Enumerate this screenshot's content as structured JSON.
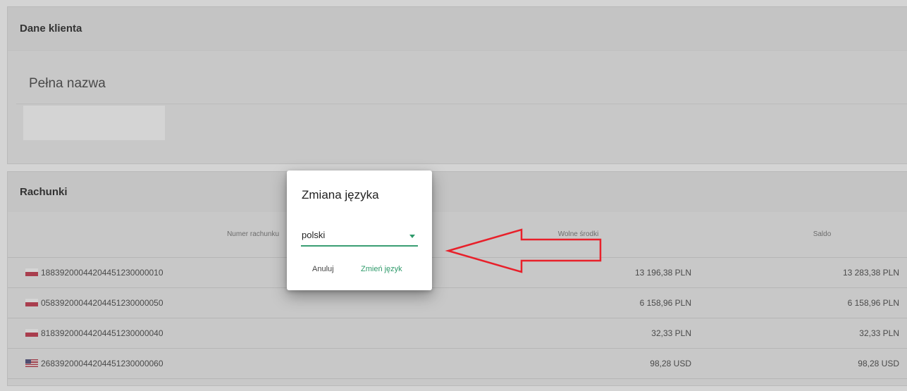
{
  "client_card": {
    "title": "Dane klienta",
    "full_name_label": "Pełna nazwa",
    "full_name_value": ""
  },
  "accounts_card": {
    "title": "Rachunki",
    "columns": {
      "number": "Numer rachunku",
      "available": "Wolne środki",
      "balance": "Saldo"
    },
    "rows": [
      {
        "flag": "pl-flag",
        "number": "18839200044204451230000010",
        "available": "13 196,38 PLN",
        "balance": "13 283,38 PLN"
      },
      {
        "flag": "pl-flag",
        "number": "05839200044204451230000050",
        "available": "6 158,96 PLN",
        "balance": "6 158,96 PLN"
      },
      {
        "flag": "pl-flag",
        "number": "81839200044204451230000040",
        "available": "32,33 PLN",
        "balance": "32,33 PLN"
      },
      {
        "flag": "us-flag",
        "number": "26839200044204451230000060",
        "available": "98,28 USD",
        "balance": "98,28 USD"
      }
    ]
  },
  "dialog": {
    "title": "Zmiana języka",
    "language_value": "polski",
    "cancel_label": "Anuluj",
    "confirm_label": "Zmień język"
  },
  "colors": {
    "accent_green": "#2e9a6a",
    "arrow_red": "#e8202a"
  }
}
